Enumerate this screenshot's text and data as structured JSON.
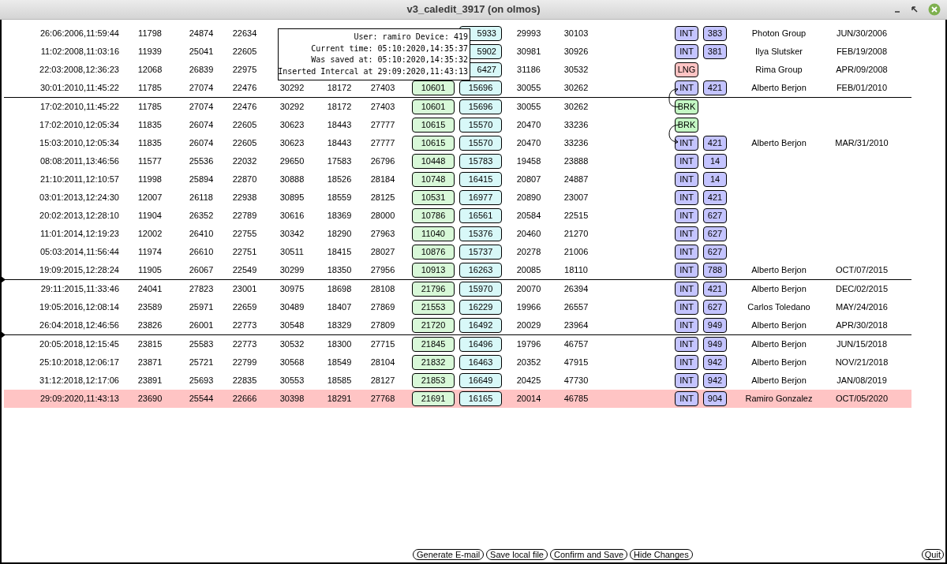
{
  "window": {
    "title": "v3_caledit_3917 (on olmos)"
  },
  "tooltip": {
    "lines": [
      "User: ramiro Device: 419",
      "Current time: 05:10:2020,14:35:37",
      "Was saved at: 05:10:2020,14:35:32",
      "Inserted Intercal at 29:09:2020,11:43:13"
    ]
  },
  "rows": [
    {
      "date": "26:06:2006,11:59:44",
      "values": [
        "11798",
        "24874",
        "22634"
      ],
      "cyan": "5933",
      "extra": [
        "29993",
        "30103"
      ],
      "tag": {
        "text": "INT",
        "kind": "int"
      },
      "code": "383",
      "name": "Photon Group",
      "date2": "JUN/30/2006",
      "highlighted": false
    },
    {
      "date": "11:02:2008,11:03:16",
      "values": [
        "11939",
        "25041",
        "22605"
      ],
      "cyan": "5902",
      "extra": [
        "30981",
        "30926"
      ],
      "tag": {
        "text": "INT",
        "kind": "int"
      },
      "code": "381",
      "name": "Ilya Slutsker",
      "date2": "FEB/19/2008",
      "highlighted": false
    },
    {
      "date": "22:03:2008,12:36:23",
      "values": [
        "12068",
        "26839",
        "22975"
      ],
      "cyan": "6427",
      "extra": [
        "31186",
        "30532"
      ],
      "tag": {
        "text": "LNG",
        "kind": "lng"
      },
      "name": "Rima Group",
      "date2": "APR/09/2008",
      "highlighted": false
    },
    {
      "date": "30:01:2010,11:45:22",
      "values": [
        "11785",
        "27074",
        "22476",
        "30292",
        "18172",
        "27403"
      ],
      "green": "10601",
      "cyan": "15696",
      "extra": [
        "30055",
        "30262"
      ],
      "tag": {
        "text": "INT",
        "kind": "int"
      },
      "code": "421",
      "name": "Alberto Berjon",
      "date2": "FEB/01/2010",
      "highlighted": false,
      "divider_below": true,
      "divider_marker": false
    },
    {
      "date": "17:02:2010,11:45:22",
      "values": [
        "11785",
        "27074",
        "22476",
        "30292",
        "18172",
        "27403"
      ],
      "green": "10601",
      "cyan": "15696",
      "extra": [
        "30055",
        "30262"
      ],
      "tag": {
        "text": "BRK",
        "kind": "brk"
      },
      "linked_to_previous": true,
      "linked_to_next": false,
      "highlighted": false
    },
    {
      "date": "17:02:2010,12:05:34",
      "values": [
        "11835",
        "26074",
        "22605",
        "30623",
        "18443",
        "27777"
      ],
      "green": "10615",
      "cyan": "15570",
      "extra": [
        "20470",
        "33236"
      ],
      "tag": {
        "text": "BRK",
        "kind": "brk"
      },
      "linked_to_previous": false,
      "linked_to_next": true,
      "highlighted": false
    },
    {
      "date": "15:03:2010,12:05:34",
      "values": [
        "11835",
        "26074",
        "22605",
        "30623",
        "18443",
        "27777"
      ],
      "green": "10615",
      "cyan": "15570",
      "extra": [
        "20470",
        "33236"
      ],
      "tag": {
        "text": "INT",
        "kind": "int"
      },
      "code": "421",
      "name": "Alberto Berjon",
      "date2": "MAR/31/2010",
      "highlighted": false
    },
    {
      "date": "08:08:2011,13:46:56",
      "values": [
        "11577",
        "25536",
        "22032",
        "29650",
        "17583",
        "26796"
      ],
      "green": "10448",
      "cyan": "15783",
      "extra": [
        "19458",
        "23888"
      ],
      "tag": {
        "text": "INT",
        "kind": "int"
      },
      "code": "14",
      "highlighted": false
    },
    {
      "date": "21:10:2011,12:10:57",
      "values": [
        "11998",
        "25894",
        "22870",
        "30888",
        "18526",
        "28184"
      ],
      "green": "10748",
      "cyan": "16415",
      "extra": [
        "20807",
        "24887"
      ],
      "tag": {
        "text": "INT",
        "kind": "int"
      },
      "code": "14",
      "highlighted": false
    },
    {
      "date": "03:01:2013,12:24:30",
      "values": [
        "12007",
        "26118",
        "22938",
        "30895",
        "18559",
        "28125"
      ],
      "green": "10531",
      "cyan": "16977",
      "extra": [
        "20890",
        "23007"
      ],
      "tag": {
        "text": "INT",
        "kind": "int"
      },
      "code": "421",
      "highlighted": false
    },
    {
      "date": "20:02:2013,12:28:10",
      "values": [
        "11904",
        "26352",
        "22789",
        "30616",
        "18369",
        "28000"
      ],
      "green": "10786",
      "cyan": "16561",
      "extra": [
        "20584",
        "22515"
      ],
      "tag": {
        "text": "INT",
        "kind": "int"
      },
      "code": "627",
      "highlighted": false
    },
    {
      "date": "11:01:2014,12:19:23",
      "values": [
        "12002",
        "26410",
        "22755",
        "30342",
        "18290",
        "27963"
      ],
      "green": "11040",
      "cyan": "15376",
      "extra": [
        "20460",
        "21270"
      ],
      "tag": {
        "text": "INT",
        "kind": "int"
      },
      "code": "627",
      "highlighted": false
    },
    {
      "date": "05:03:2014,11:56:44",
      "values": [
        "11974",
        "26610",
        "22751",
        "30511",
        "18415",
        "28027"
      ],
      "green": "10876",
      "cyan": "15737",
      "extra": [
        "20278",
        "21006"
      ],
      "tag": {
        "text": "INT",
        "kind": "int"
      },
      "code": "627",
      "highlighted": false
    },
    {
      "date": "19:09:2015,12:28:24",
      "values": [
        "11905",
        "26067",
        "22549",
        "30299",
        "18350",
        "27956"
      ],
      "green": "10913",
      "cyan": "16263",
      "extra": [
        "20085",
        "18110"
      ],
      "tag": {
        "text": "INT",
        "kind": "int"
      },
      "code": "788",
      "name": "Alberto Berjon",
      "date2": "OCT/07/2015",
      "highlighted": false,
      "divider_below": true,
      "divider_marker": true
    },
    {
      "date": "29:11:2015,11:33:46",
      "values": [
        "24041",
        "27823",
        "23001",
        "30975",
        "18698",
        "28108"
      ],
      "green": "21796",
      "cyan": "15970",
      "extra": [
        "20070",
        "26394"
      ],
      "tag": {
        "text": "INT",
        "kind": "int"
      },
      "code": "421",
      "name": "Alberto Berjon",
      "date2": "DEC/02/2015",
      "highlighted": false
    },
    {
      "date": "19:05:2016,12:08:14",
      "values": [
        "23589",
        "25971",
        "22659",
        "30489",
        "18407",
        "27869"
      ],
      "green": "21553",
      "cyan": "16229",
      "extra": [
        "19966",
        "26557"
      ],
      "tag": {
        "text": "INT",
        "kind": "int"
      },
      "code": "627",
      "name": "Carlos Toledano",
      "date2": "MAY/24/2016",
      "highlighted": false
    },
    {
      "date": "26:04:2018,12:46:56",
      "values": [
        "23826",
        "26001",
        "22773",
        "30548",
        "18329",
        "27809"
      ],
      "green": "21720",
      "cyan": "16492",
      "extra": [
        "20029",
        "23964"
      ],
      "tag": {
        "text": "INT",
        "kind": "int"
      },
      "code": "949",
      "name": "Alberto Berjon",
      "date2": "APR/30/2018",
      "highlighted": false,
      "divider_below": true,
      "divider_marker": true
    },
    {
      "date": "20:05:2018,12:15:45",
      "values": [
        "23815",
        "25583",
        "22773",
        "30532",
        "18300",
        "27715"
      ],
      "green": "21845",
      "cyan": "16496",
      "extra": [
        "19796",
        "46757"
      ],
      "tag": {
        "text": "INT",
        "kind": "int"
      },
      "code": "949",
      "name": "Alberto Berjon",
      "date2": "JUN/15/2018",
      "highlighted": false
    },
    {
      "date": "25:10:2018,12:06:17",
      "values": [
        "23871",
        "25721",
        "22799",
        "30568",
        "18549",
        "28104"
      ],
      "green": "21832",
      "cyan": "16463",
      "extra": [
        "20352",
        "47915"
      ],
      "tag": {
        "text": "INT",
        "kind": "int"
      },
      "code": "942",
      "name": "Alberto Berjon",
      "date2": "NOV/21/2018",
      "highlighted": false
    },
    {
      "date": "31:12:2018,12:17:06",
      "values": [
        "23891",
        "25693",
        "22835",
        "30553",
        "18585",
        "28127"
      ],
      "green": "21853",
      "cyan": "16649",
      "extra": [
        "20425",
        "47730"
      ],
      "tag": {
        "text": "INT",
        "kind": "int"
      },
      "code": "942",
      "name": "Alberto Berjon",
      "date2": "JAN/08/2019",
      "highlighted": false
    },
    {
      "date": "29:09:2020,11:43:13",
      "values": [
        "23690",
        "25544",
        "22666",
        "30398",
        "18291",
        "27768"
      ],
      "green": "21691",
      "cyan": "16165",
      "extra": [
        "20014",
        "46785"
      ],
      "tag": {
        "text": "INT",
        "kind": "int"
      },
      "code": "904",
      "name": "Ramiro Gonzalez",
      "date2": "OCT/05/2020",
      "highlighted": true
    }
  ],
  "buttons": [
    {
      "label": "Generate E-mail"
    },
    {
      "label": "Save local file"
    },
    {
      "label": "Confirm and Save"
    },
    {
      "label": "Hide Changes"
    }
  ],
  "quit": {
    "label": "Quit"
  }
}
